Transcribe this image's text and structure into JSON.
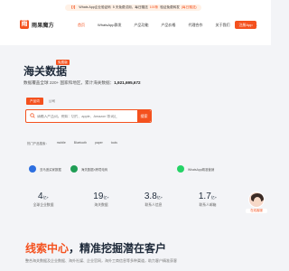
{
  "brand": {
    "logo_mark": "雨",
    "name": "雨果魔方"
  },
  "announcement": {
    "lead": "【!】",
    "text1": "Whats App企业验证码",
    "text2": "5 天免费试用，每日赠送",
    "highlight": "100条",
    "text3": "验证免费转发",
    "link": "(每日赠送)"
  },
  "nav": {
    "items": [
      "首页",
      "WhatsApp群发",
      "产品功能",
      "产品价格",
      "代理合作",
      "关于我们",
      "帮助中心"
    ],
    "active_index": 0,
    "cta": "注册App"
  },
  "hero": {
    "title": "海关数据",
    "badge": "免费版",
    "desc_prefix": "数据覆盖全球 220+ 国家和地区，累计海关数据：",
    "desc_count": "1,921,695,672"
  },
  "search": {
    "tabs": [
      "产品词",
      "公司"
    ],
    "placeholder": "请输入产品词，例如：切片、apple、Amazon 等词汇",
    "button": "搜索"
  },
  "hot": {
    "label": "热门产品搜索：",
    "tags": [
      "mobile",
      "Bluetooth",
      "paper",
      "tools"
    ]
  },
  "partners": [
    {
      "name": "亚马逊买家数据",
      "color": "#2d6fe0"
    },
    {
      "name": "海关数据×跨境电商",
      "color": "#1f9d55"
    },
    {
      "name": "WhatsApp精准营销",
      "color": "#25d366"
    }
  ],
  "stats": [
    {
      "value": "4",
      "unit": "亿+",
      "label": "全球企业数据"
    },
    {
      "value": "19",
      "unit": "亿+",
      "label": "海关数据"
    },
    {
      "value": "3.8",
      "unit": "亿+",
      "label": "联系人信息"
    },
    {
      "value": "1.7",
      "unit": "亿+",
      "label": "联系人邮箱"
    }
  ],
  "customer_service": {
    "label": "在线客服"
  },
  "bottom": {
    "title_accent": "线索中心",
    "title_rest": "，精准挖掘潜在客户",
    "desc": "整合海关数据及企业数据、海外社媒、企业官网，海外工商信息等多种渠道，助力客户精准获客"
  }
}
